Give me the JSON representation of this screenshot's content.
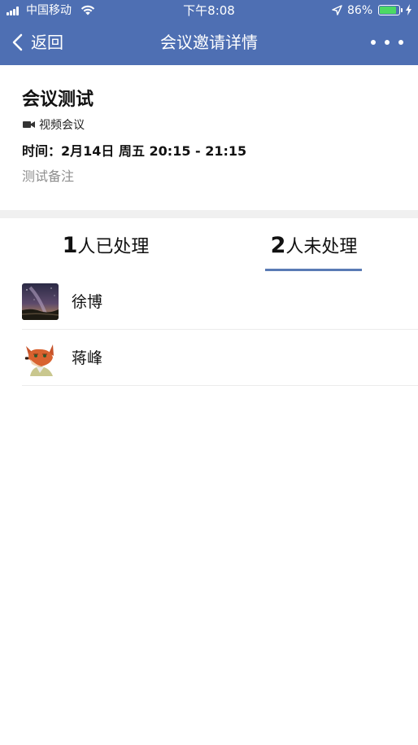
{
  "status_bar": {
    "carrier": "中国移动",
    "time": "下午8:08",
    "battery_percent": "86%",
    "battery_level": 0.86,
    "icons": [
      "signal-icon",
      "wifi-icon",
      "location-arrow-icon",
      "battery-icon",
      "charging-icon"
    ]
  },
  "nav": {
    "back_label": "返回",
    "title": "会议邀请详情",
    "back_icon": "chevron-left-icon",
    "more_icon": "more-dots-icon"
  },
  "meeting": {
    "title": "会议测试",
    "type_label": "视频会议",
    "type_icon": "video-camera-icon",
    "time": "时间：2月14日 周五 20:15 - 21:15",
    "note": "测试备注"
  },
  "tabs": [
    {
      "count": "1",
      "label": "人已处理",
      "active": false
    },
    {
      "count": "2",
      "label": "人未处理",
      "active": true
    }
  ],
  "users": [
    {
      "name": "徐博",
      "avatar": "night-sky-avatar"
    },
    {
      "name": "蒋峰",
      "avatar": "fox-cartoon-avatar"
    }
  ],
  "colors": {
    "header_bg": "#4e6fb3",
    "tab_indicator": "#5a7bb5",
    "battery_fill": "#4cd964",
    "note_text": "#8e8e8e",
    "divider_bg": "#f0f0f0"
  }
}
